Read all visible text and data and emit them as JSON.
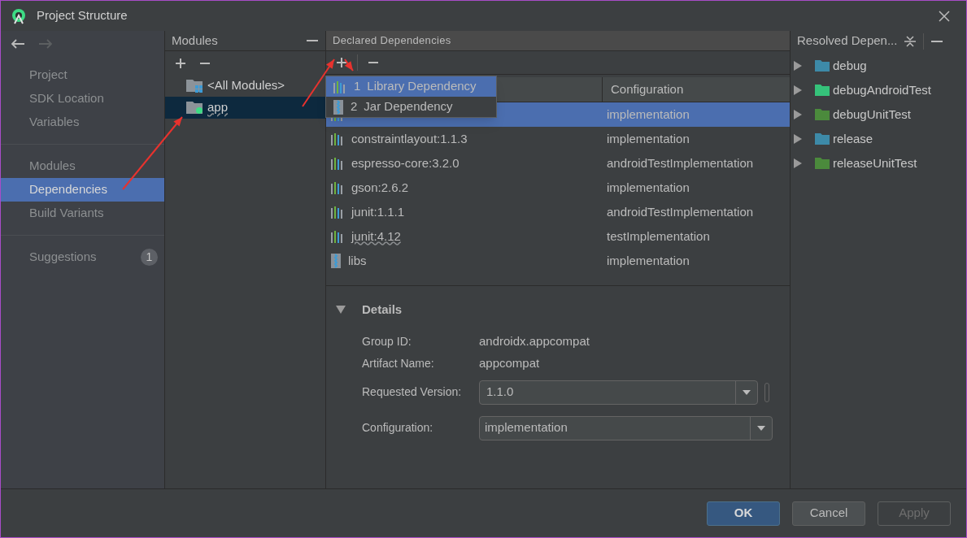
{
  "window": {
    "title": "Project Structure"
  },
  "sidebar": {
    "groups": [
      [
        {
          "label": "Project",
          "selected": false
        },
        {
          "label": "SDK Location",
          "selected": false
        },
        {
          "label": "Variables",
          "selected": false
        }
      ],
      [
        {
          "label": "Modules",
          "selected": false
        },
        {
          "label": "Dependencies",
          "selected": true
        },
        {
          "label": "Build Variants",
          "selected": false
        }
      ],
      [
        {
          "label": "Suggestions",
          "selected": false,
          "badge": "1"
        }
      ]
    ]
  },
  "modules": {
    "title": "Modules",
    "items": [
      {
        "label": "<All Modules>",
        "kind": "all",
        "selected": false,
        "warning": false
      },
      {
        "label": "app",
        "kind": "module",
        "selected": true,
        "warning": true
      }
    ]
  },
  "declared": {
    "title": "Declared Dependencies",
    "columns": [
      "Configuration"
    ],
    "rows": [
      {
        "configuration": "implementation",
        "kind": "library",
        "selected": true
      },
      {
        "name": "constraintlayout:1.1.3",
        "configuration": "implementation",
        "kind": "library",
        "selected": false,
        "warning": false
      },
      {
        "name": "espresso-core:3.2.0",
        "configuration": "androidTestImplementation",
        "kind": "library",
        "selected": false,
        "warning": false
      },
      {
        "name": "gson:2.6.2",
        "configuration": "implementation",
        "kind": "library",
        "selected": false,
        "warning": false
      },
      {
        "name": "junit:1.1.1",
        "configuration": "androidTestImplementation",
        "kind": "library",
        "selected": false,
        "warning": false
      },
      {
        "name": "junit:4.12",
        "configuration": "testImplementation",
        "kind": "library",
        "selected": false,
        "warning": true
      },
      {
        "name": "libs",
        "configuration": "implementation",
        "kind": "jar",
        "selected": false,
        "warning": false
      }
    ],
    "menu": [
      {
        "number": "1",
        "label": "Library Dependency",
        "kind": "library",
        "selected": true
      },
      {
        "number": "2",
        "label": "Jar Dependency",
        "kind": "jar",
        "selected": false
      }
    ],
    "details": {
      "title": "Details",
      "expanded": true,
      "fields": [
        {
          "label": "Group ID:",
          "value": "androidx.appcompat",
          "kind": "text"
        },
        {
          "label": "Artifact Name:",
          "value": "appcompat",
          "kind": "text"
        },
        {
          "label": "Requested Version:",
          "value": "1.1.0",
          "kind": "combo"
        },
        {
          "label": "Configuration:",
          "value": "implementation",
          "kind": "select"
        }
      ]
    }
  },
  "resolved": {
    "title": "Resolved Depen...",
    "items": [
      {
        "label": "debug",
        "color": "#3d8aa8"
      },
      {
        "label": "debugAndroidTest",
        "color": "#35c27a"
      },
      {
        "label": "debugUnitTest",
        "color": "#4b8a3c"
      },
      {
        "label": "release",
        "color": "#3d8aa8"
      },
      {
        "label": "releaseUnitTest",
        "color": "#4b8a3c"
      }
    ]
  },
  "buttons": [
    {
      "label": "OK",
      "kind": "primary"
    },
    {
      "label": "Cancel",
      "kind": "default"
    },
    {
      "label": "Apply",
      "kind": "disabled"
    }
  ]
}
